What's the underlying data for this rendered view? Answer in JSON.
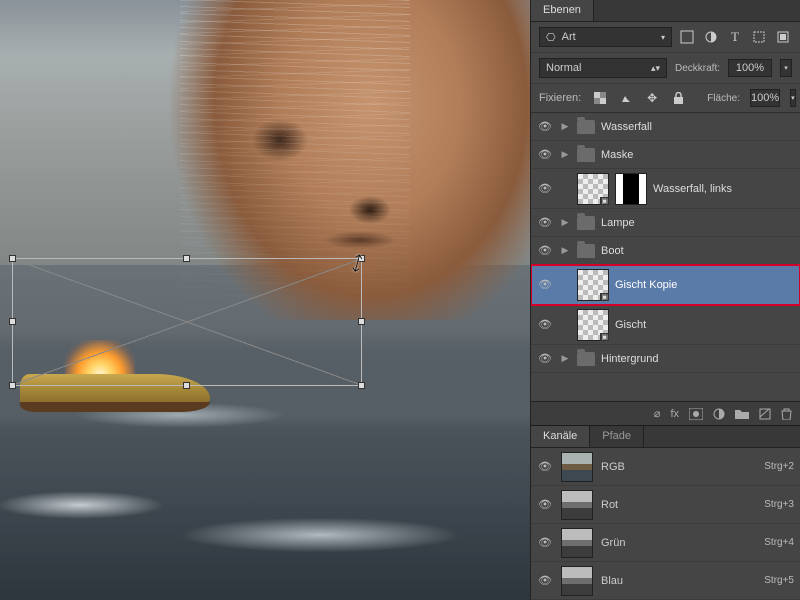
{
  "tabs": {
    "layers": "Ebenen"
  },
  "search": {
    "prefix_icon": "⎔",
    "label": "Art",
    "dropdown": "▾"
  },
  "toolbar_icons": [
    "image-filter-icon",
    "adjust-icon",
    "type-icon",
    "crop-icon",
    "shape-icon"
  ],
  "blend": {
    "mode": "Normal",
    "opacity_label": "Deckkraft:",
    "opacity_value": "100%"
  },
  "lock": {
    "label": "Fixieren:",
    "fill_label": "Fläche:",
    "fill_value": "100%"
  },
  "layers_list": [
    {
      "type": "group",
      "name": "Wasserfall"
    },
    {
      "type": "group",
      "name": "Maske"
    },
    {
      "type": "layer",
      "name": "Wasserfall, links",
      "mask": true,
      "tall": true
    },
    {
      "type": "group",
      "name": "Lampe"
    },
    {
      "type": "group",
      "name": "Boot"
    },
    {
      "type": "layer",
      "name": "Gischt Kopie",
      "selected": true,
      "highlight": true,
      "smart": true,
      "tall": true
    },
    {
      "type": "layer",
      "name": "Gischt",
      "smart": true,
      "tall": true
    },
    {
      "type": "group",
      "name": "Hintergrund"
    }
  ],
  "footer_icons": [
    "link-icon",
    "fx-icon",
    "mask-icon",
    "fill-adjust-icon",
    "group-icon",
    "new-layer-icon",
    "trash-icon"
  ],
  "footer_labels": {
    "fx": "fx"
  },
  "channels_tabs": {
    "channels": "Kanäle",
    "paths": "Pfade"
  },
  "channels": [
    {
      "name": "RGB",
      "shortcut": "Strg+2",
      "rgb": true
    },
    {
      "name": "Rot",
      "shortcut": "Strg+3"
    },
    {
      "name": "Grün",
      "shortcut": "Strg+4"
    },
    {
      "name": "Blau",
      "shortcut": "Strg+5"
    }
  ]
}
